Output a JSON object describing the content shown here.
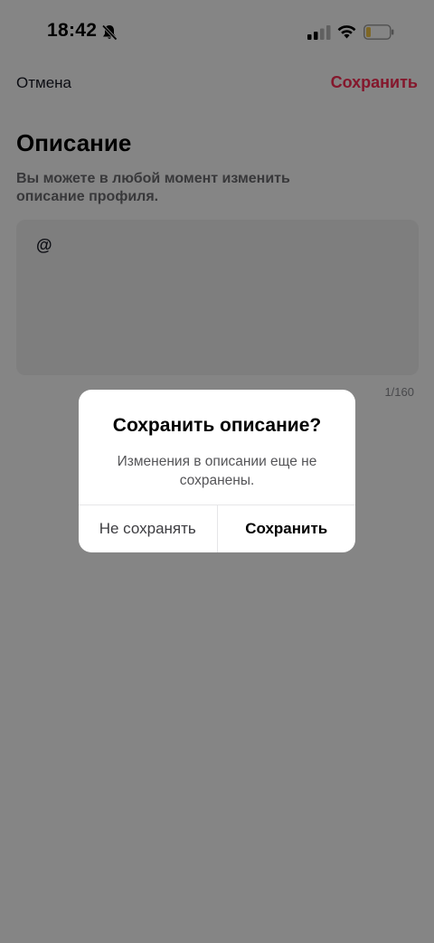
{
  "status_bar": {
    "time": "18:42",
    "icons": [
      "bell-muted-icon",
      "signal-icon",
      "wifi-icon",
      "battery-low-icon"
    ]
  },
  "header": {
    "cancel_label": "Отмена",
    "save_label": "Сохранить"
  },
  "content": {
    "title": "Описание",
    "subtitle": "Вы можете в любой момент изменить описание профиля.",
    "description_value": "@",
    "char_counter": "1/160"
  },
  "dialog": {
    "title": "Сохранить описание?",
    "message": "Изменения в описании еще не сохранены.",
    "discard_label": "Не сохранять",
    "save_label": "Сохранить"
  },
  "colors": {
    "accent": "#fe2c55",
    "overlay": "rgba(0,0,0,0.48)",
    "input_bg": "#f1f1f2"
  }
}
